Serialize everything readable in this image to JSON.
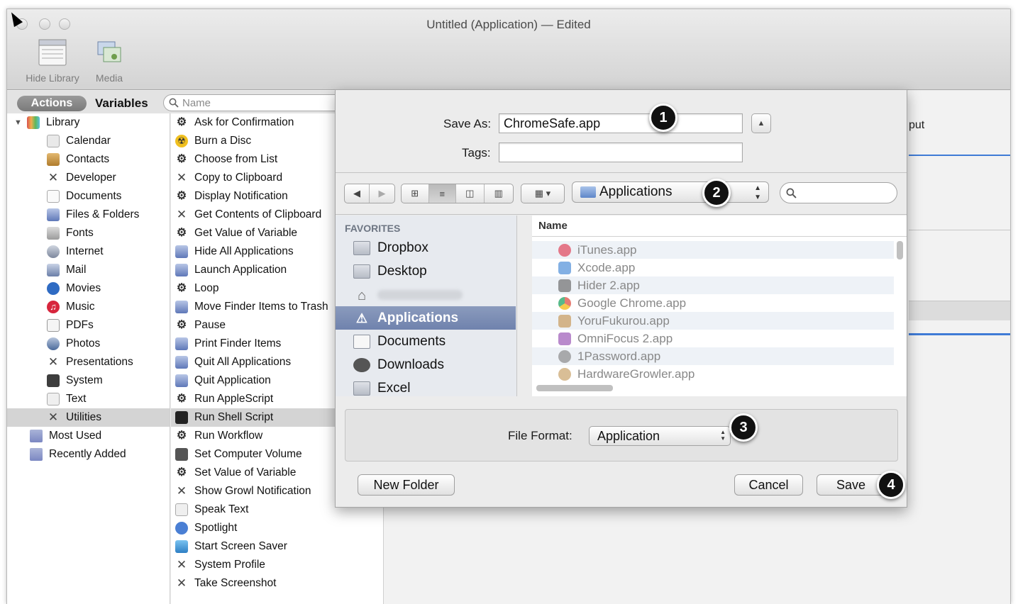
{
  "window": {
    "title": "Untitled (Application) — Edited",
    "toolbar": {
      "hide_library": "Hide Library",
      "media": "Media"
    }
  },
  "library": {
    "tab_actions": "Actions",
    "tab_variables": "Variables",
    "search_placeholder": "Name",
    "categories": [
      "Library",
      "Calendar",
      "Contacts",
      "Developer",
      "Documents",
      "Files & Folders",
      "Fonts",
      "Internet",
      "Mail",
      "Movies",
      "Music",
      "PDFs",
      "Photos",
      "Presentations",
      "System",
      "Text",
      "Utilities",
      "Most Used",
      "Recently Added"
    ],
    "actions": [
      "Ask for Confirmation",
      "Burn a Disc",
      "Choose from List",
      "Copy to Clipboard",
      "Display Notification",
      "Get Contents of Clipboard",
      "Get Value of Variable",
      "Hide All Applications",
      "Launch Application",
      "Loop",
      "Move Finder Items to Trash",
      "Pause",
      "Print Finder Items",
      "Quit All Applications",
      "Quit Application",
      "Run AppleScript",
      "Run Shell Script",
      "Run Workflow",
      "Set Computer Volume",
      "Set Value of Variable",
      "Show Growl Notification",
      "Speak Text",
      "Spotlight",
      "Start Screen Saver",
      "System Profile",
      "Take Screenshot"
    ],
    "selected_category": "Utilities",
    "selected_action": "Run Shell Script"
  },
  "save_sheet": {
    "save_as_label": "Save As:",
    "save_as_value": "ChromeSafe.app",
    "tags_label": "Tags:",
    "tags_value": "",
    "location": "Applications",
    "sidebar_header": "FAVORITES",
    "sidebar_items": [
      "Dropbox",
      "Desktop",
      "",
      "Applications",
      "Documents",
      "Downloads",
      "Excel"
    ],
    "selected_sidebar_item": "Applications",
    "column_header": "Name",
    "files": [
      "iTunes.app",
      "Xcode.app",
      "Hider 2.app",
      "Google Chrome.app",
      "YoruFukurou.app",
      "OmniFocus 2.app",
      "1Password.app",
      "HardwareGrowler.app"
    ],
    "file_format_label": "File Format:",
    "file_format_value": "Application",
    "new_folder_button": "New Folder",
    "cancel_button": "Cancel",
    "save_button": "Save"
  },
  "annotations": [
    "1",
    "2",
    "3",
    "4"
  ],
  "background_text": {
    "input_fragment": "put"
  },
  "colors": {
    "selection_blue": "#6f82ad",
    "badge": "#111111",
    "workflow_accent": "#3f7bd6"
  }
}
